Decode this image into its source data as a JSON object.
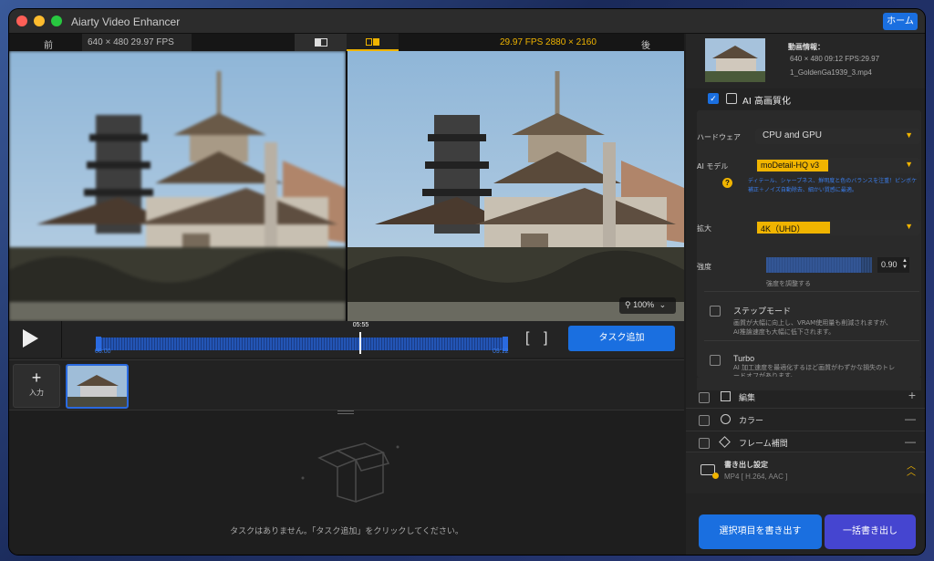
{
  "window": {
    "title": "Aiarty Video Enhancer",
    "home_label": "ホーム"
  },
  "compare": {
    "before_label": "前",
    "before_info": "640 × 480  29.97 FPS",
    "after_info": "29.97 FPS   2880 × 2160",
    "after_label": "後"
  },
  "preview": {
    "zoom": "100%"
  },
  "timeline": {
    "current_time": "05:55",
    "start_time": "00:00",
    "end_time": "09:12",
    "add_task_label": "タスク追加",
    "progress_fraction": 0.643
  },
  "input": {
    "add_label": "入力"
  },
  "tasks": {
    "empty_message": "タスクはありません。「タスク追加」をクリックしてください。"
  },
  "video_info": {
    "heading": "動画情報：",
    "details": "640 × 480 09:12 FPS:29.97",
    "filename": "1_GoldenGa1939_3.mp4"
  },
  "enhance": {
    "title": "AI 高画質化",
    "hardware_label": "ハードウェア",
    "hardware_value": "CPU and GPU",
    "model_label": "AI モデル",
    "model_value": "moDetail-HQ  v3",
    "model_desc": "ディテール、シャープネス、鮮明度と色のバランスを注重！ピンボケ補正＋ノイズ自動除去、細かい質感に最適。",
    "scale_label": "拡大",
    "scale_value": "4K（UHD）",
    "strength_label": "強度",
    "strength_value": "0.90",
    "strength_hint": "強度を調整する"
  },
  "step_mode": {
    "label": "ステップモード",
    "desc": "画質が大幅に向上し、VRAM使用量も削減されますが、AI推論速度も大幅に低下されます。"
  },
  "turbo": {
    "label": "Turbo",
    "desc": "AI 加工速度を最適化するほど画質がわずかな損失のトレードオフがあります。"
  },
  "sections": [
    {
      "label": "編集",
      "action": "+"
    },
    {
      "label": "カラー",
      "action": "—"
    },
    {
      "label": "フレーム補間",
      "action": "—"
    }
  ],
  "export": {
    "title": "書き出し設定",
    "format": "MP4 [ H.264, AAC ]",
    "export_selected": "選択項目を書き出す",
    "export_all": "一括書き出し"
  },
  "colors": {
    "accent": "#1a6fe0",
    "gold": "#f0b400"
  }
}
